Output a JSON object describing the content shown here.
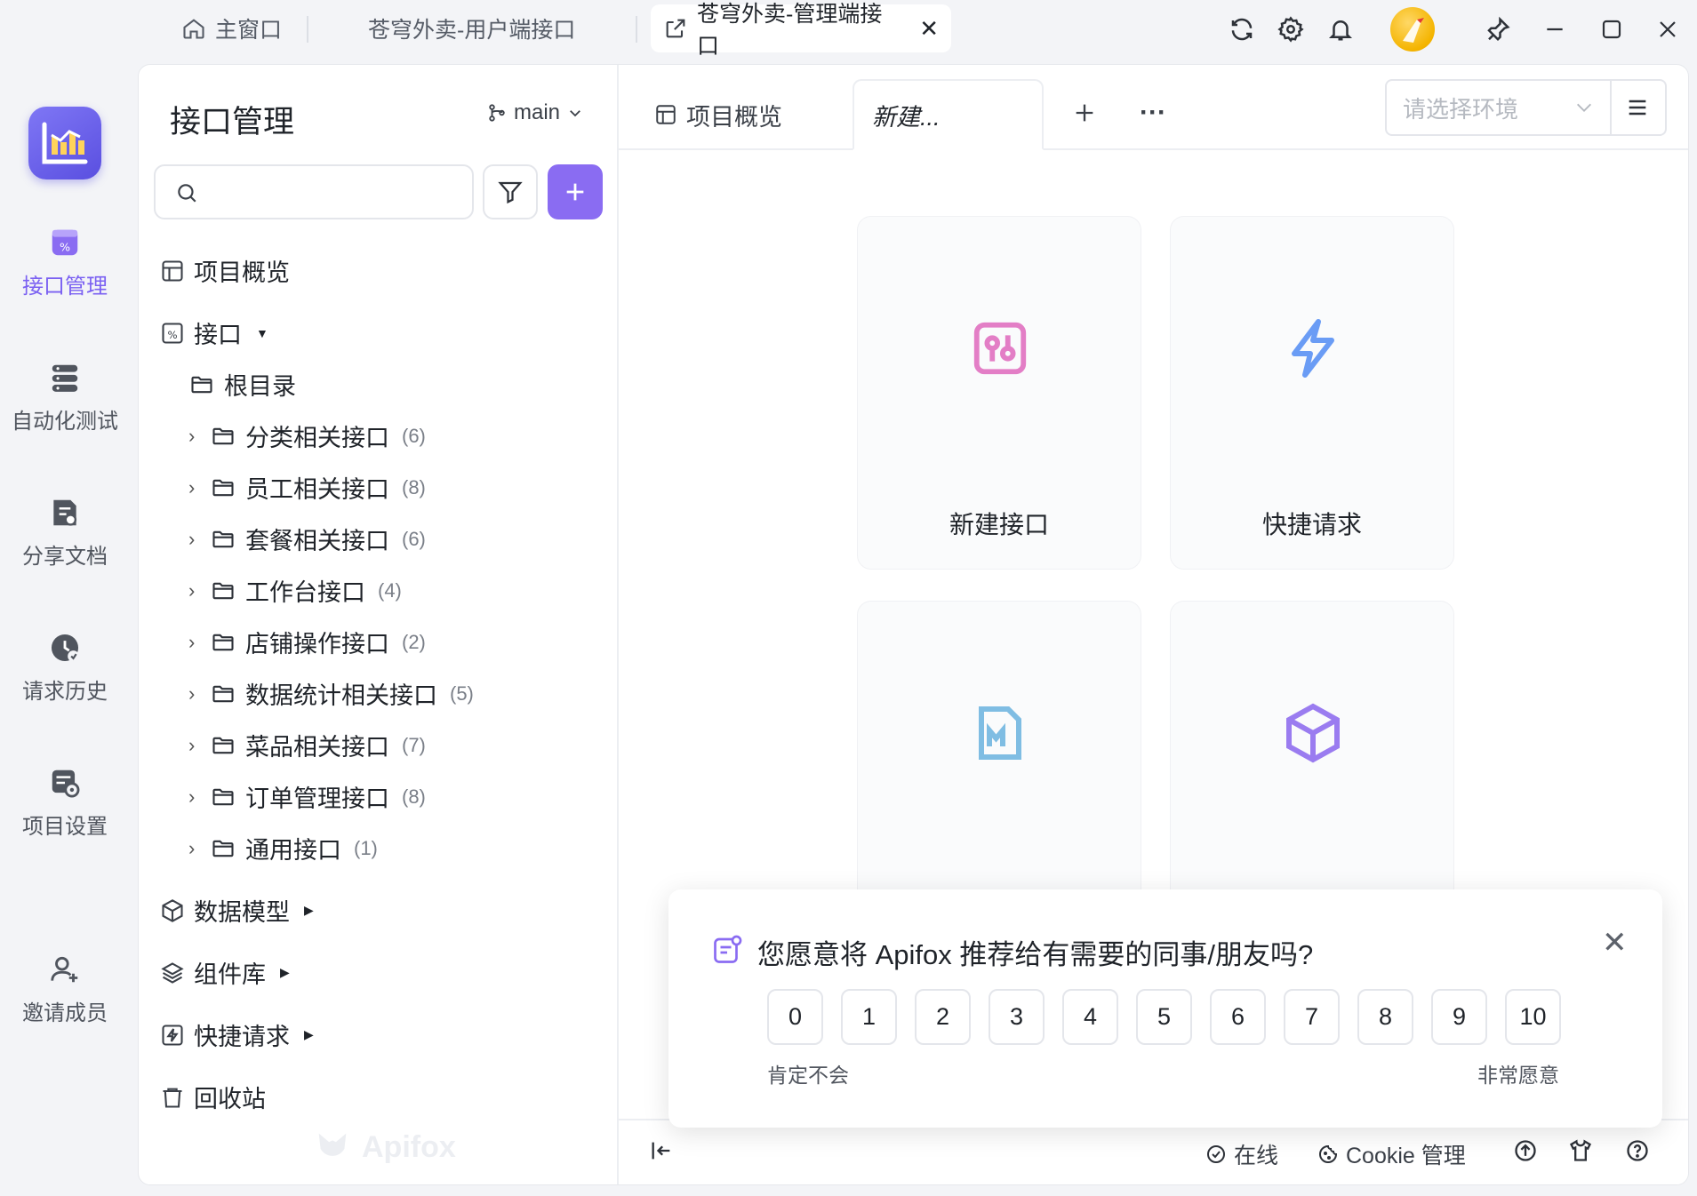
{
  "titlebar": {
    "tabs": [
      {
        "label": "主窗口",
        "icon": "home-icon"
      },
      {
        "label": "苍穹外卖-用户端接口"
      },
      {
        "label": "苍穹外卖-管理端接口",
        "icon": "external-link-icon",
        "close": "✕"
      }
    ],
    "icons": [
      "refresh-icon",
      "gear-icon",
      "bell-icon",
      "avatar",
      "pin-icon",
      "minimize-icon",
      "maximize-icon",
      "close-icon"
    ]
  },
  "rail": {
    "items": [
      {
        "label": "接口管理",
        "icon": "api-icon",
        "active": true
      },
      {
        "label": "自动化测试",
        "icon": "server-stack-icon"
      },
      {
        "label": "分享文档",
        "icon": "share-doc-icon"
      },
      {
        "label": "请求历史",
        "icon": "history-icon"
      },
      {
        "label": "项目设置",
        "icon": "project-settings-icon"
      },
      {
        "label": "邀请成员",
        "icon": "invite-user-icon"
      }
    ]
  },
  "sidebar": {
    "title": "接口管理",
    "branch": "main",
    "search_placeholder": "",
    "overview": "项目概览",
    "api_root": "接口",
    "root_folder": "根目录",
    "folders": [
      {
        "name": "分类相关接口",
        "count": "(6)"
      },
      {
        "name": "员工相关接口",
        "count": "(8)"
      },
      {
        "name": "套餐相关接口",
        "count": "(6)"
      },
      {
        "name": "工作台接口",
        "count": "(4)"
      },
      {
        "name": "店铺操作接口",
        "count": "(2)"
      },
      {
        "name": "数据统计相关接口",
        "count": "(5)"
      },
      {
        "name": "菜品相关接口",
        "count": "(7)"
      },
      {
        "name": "订单管理接口",
        "count": "(8)"
      },
      {
        "name": "通用接口",
        "count": "(1)"
      }
    ],
    "sections": [
      {
        "label": "数据模型",
        "icon": "cube-icon"
      },
      {
        "label": "组件库",
        "icon": "layers-icon"
      },
      {
        "label": "快捷请求",
        "icon": "flash-icon"
      },
      {
        "label": "回收站",
        "icon": "trash-icon"
      }
    ],
    "watermark": "Apifox"
  },
  "content": {
    "tabs": [
      {
        "label": "项目概览"
      },
      {
        "label": "新建..."
      }
    ],
    "more": "···",
    "env_placeholder": "请选择环境",
    "cards": [
      {
        "label": "新建接口",
        "icon": "new-api-icon",
        "color": "#e37ec6"
      },
      {
        "label": "快捷请求",
        "icon": "flash-icon",
        "color": "#6a9cf5"
      },
      {
        "label": "",
        "icon": "markdown-icon",
        "color": "#7fbde3"
      },
      {
        "label": "",
        "icon": "cube-icon",
        "color": "#9a7cf0"
      }
    ],
    "status": {
      "online": "在线",
      "cookie": "Cookie 管理"
    }
  },
  "survey": {
    "question": "您愿意将 Apifox 推荐给有需要的同事/朋友吗?",
    "scores": [
      "0",
      "1",
      "2",
      "3",
      "4",
      "5",
      "6",
      "7",
      "8",
      "9",
      "10"
    ],
    "low_label": "肯定不会",
    "high_label": "非常愿意",
    "close": "✕"
  },
  "colors": {
    "accent": "#8a6cf2",
    "rail_active": "#7b61f2",
    "background": "#f3f4f7"
  }
}
